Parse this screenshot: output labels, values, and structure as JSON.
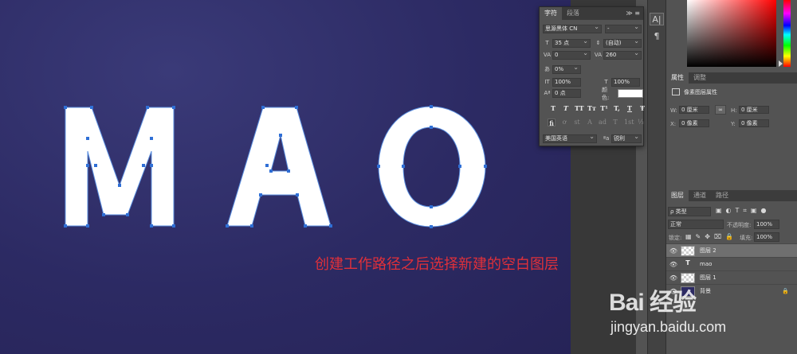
{
  "canvas": {
    "annotation": "创建工作路径之后选择新建的空白图层",
    "letters": [
      "M",
      "A",
      "O"
    ]
  },
  "mini_toolbar": {
    "char_icon": "A|",
    "para_icon": "¶"
  },
  "character_panel": {
    "tabs": [
      "字符",
      "段落"
    ],
    "menu": "≫ ≡",
    "font_family": "思源黑体 CN",
    "font_style": "-",
    "font_size": "35 点",
    "leading": "(自动)",
    "kerning": "0",
    "tracking": "260",
    "tsume": "0%",
    "vertical_scale": "100%",
    "horizontal_scale": "100%",
    "baseline_shift": "0 点",
    "color_label": "颜色:",
    "text_color": "#ffffff",
    "type_buttons": [
      "T",
      "T",
      "TT",
      "Tт",
      "T¹",
      "T,",
      "T",
      "Ŧ"
    ],
    "opentype_buttons": [
      "fi",
      "ơ",
      "st",
      "A",
      "ad",
      "T",
      "1st",
      "½"
    ],
    "language": "美国英语",
    "aa_icon": "ªa",
    "antialias": "锐利"
  },
  "properties": {
    "tabs": [
      "属性",
      "调整"
    ],
    "header": "像素图层属性",
    "w_label": "W:",
    "w": "0 厘米",
    "h_label": "H:",
    "h": "0 厘米",
    "x_label": "X:",
    "x": "0 像素",
    "y_label": "Y:",
    "y": "0 像素"
  },
  "layers": {
    "tabs": [
      "图层",
      "通道",
      "路径"
    ],
    "filter_kind": "ρ 类型",
    "blend_mode": "正常",
    "opacity_label": "不透明度:",
    "opacity": "100%",
    "lock_label": "锁定:",
    "fill_label": "填充:",
    "fill": "100%",
    "items": [
      {
        "name": "图层 2",
        "type": "pixel",
        "selected": true
      },
      {
        "name": "mao",
        "type": "text",
        "selected": false
      },
      {
        "name": "图层 1",
        "type": "pixel",
        "selected": false
      },
      {
        "name": "背景",
        "type": "pixel",
        "selected": false
      }
    ]
  },
  "watermark": {
    "logo": "Bai 经验",
    "url": "jingyan.baidu.com"
  },
  "colors": {
    "canvas_bg": "#2c2a63",
    "annotation": "#e0303a",
    "path_anchor": "#2f6fd6"
  }
}
